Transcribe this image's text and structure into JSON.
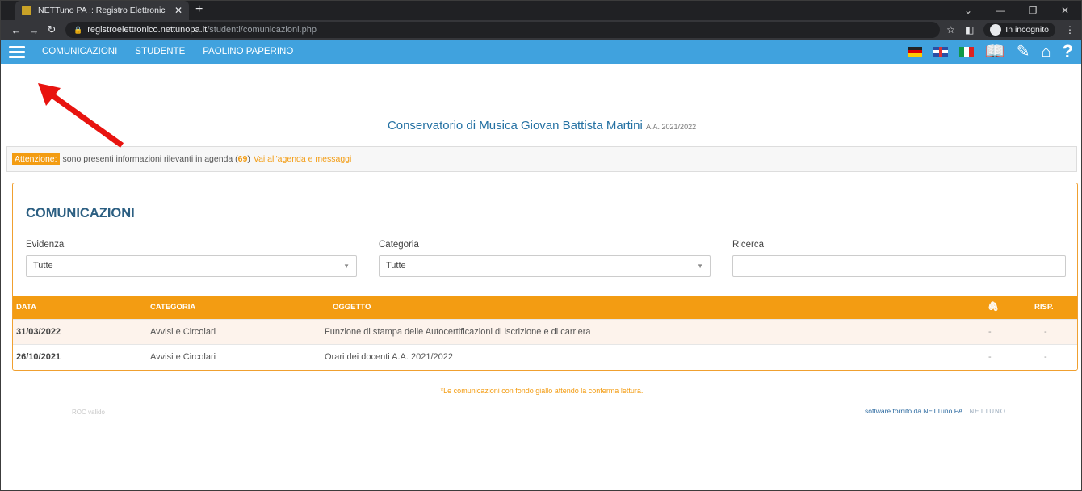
{
  "browser": {
    "tab_title": "NETTuno PA :: Registro Elettronic",
    "url_host": "registroelettronico.nettunopa.it",
    "url_path": "/studenti/comunicazioni.php",
    "incognito_label": "In incognito"
  },
  "nav": {
    "items": [
      "COMUNICAZIONI",
      "STUDENTE",
      "PAOLINO PAPERINO"
    ]
  },
  "institution": {
    "name": "Conservatorio di Musica Giovan Battista Martini",
    "academic_year": "A.A. 2021/2022"
  },
  "alert": {
    "tag": "Attenzione:",
    "text_before": "sono presenti informazioni rilevanti in agenda (",
    "count": "69",
    "text_after": ")",
    "link": "Vai all'agenda e messaggi"
  },
  "panel": {
    "title": "COMUNICAZIONI",
    "filters": {
      "evidenza_label": "Evidenza",
      "evidenza_value": "Tutte",
      "categoria_label": "Categoria",
      "categoria_value": "Tutte",
      "ricerca_label": "Ricerca",
      "ricerca_value": ""
    },
    "columns": {
      "data": "DATA",
      "categoria": "CATEGORIA",
      "oggetto": "OGGETTO",
      "risp": "RISP."
    },
    "rows": [
      {
        "data": "31/03/2022",
        "categoria": "Avvisi e Circolari",
        "oggetto": "Funzione di stampa delle Autocertificazioni di iscrizione e di carriera",
        "allegato": "-",
        "risp": "-"
      },
      {
        "data": "26/10/2021",
        "categoria": "Avvisi e Circolari",
        "oggetto": "Orari dei docenti A.A. 2021/2022",
        "allegato": "-",
        "risp": "-"
      }
    ]
  },
  "footer": {
    "note": "*Le comunicazioni con fondo giallo attendo la conferma lettura.",
    "roc": "ROC valido",
    "software": "software fornito da NETTuno PA",
    "logo": "NETTUNO"
  },
  "colors": {
    "nav_bg": "#40a2de",
    "accent_orange": "#f39c12",
    "title_blue": "#2c5f82",
    "annotation_red": "#e8130f"
  }
}
